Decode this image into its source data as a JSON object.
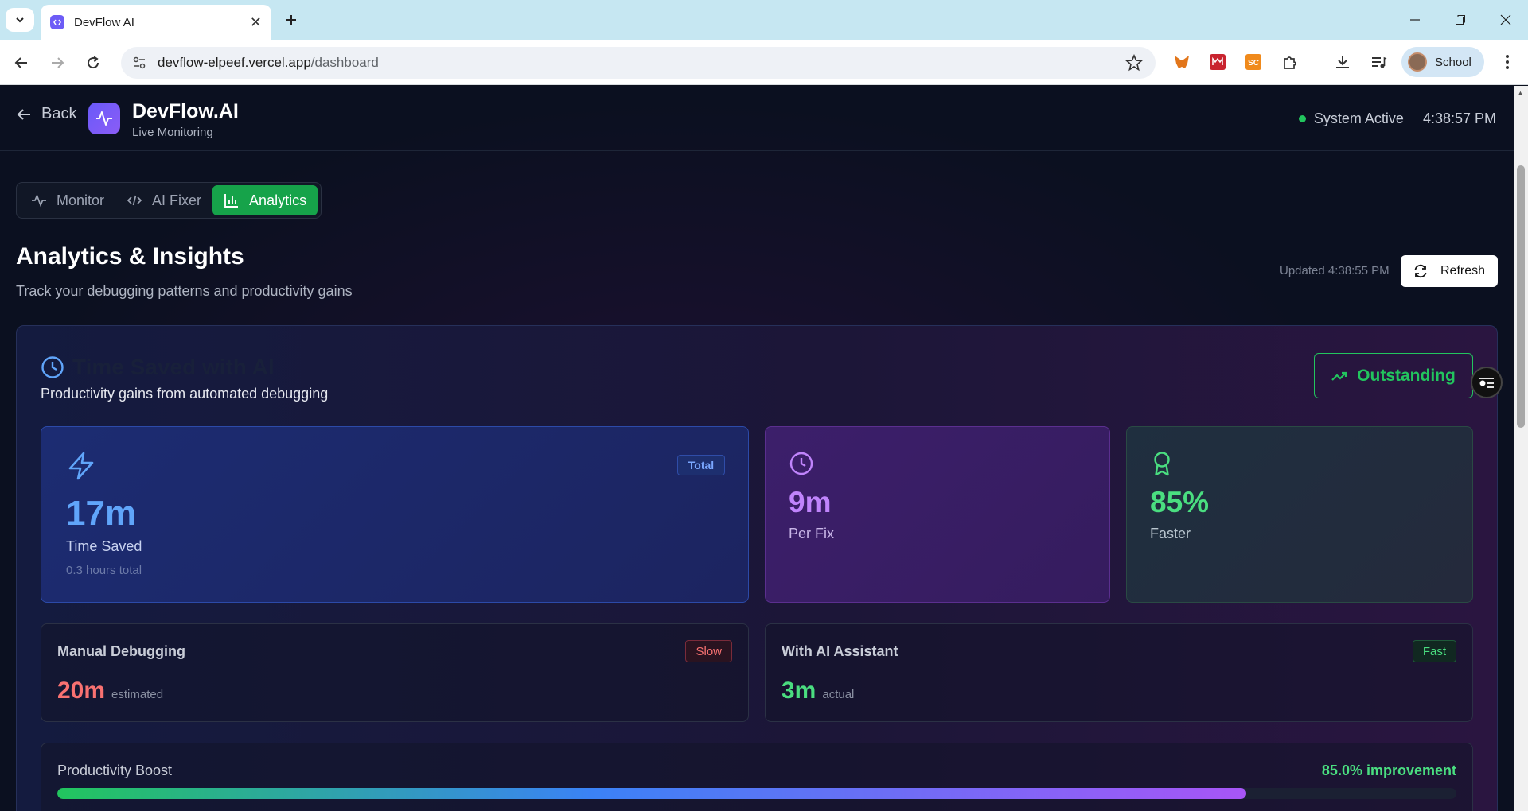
{
  "browser": {
    "tab_title": "DevFlow AI",
    "url_host": "devflow-elpeef.vercel.app",
    "url_path": "/dashboard",
    "profile_name": "School"
  },
  "header": {
    "back_label": "Back",
    "brand_name": "DevFlow.AI",
    "brand_subtitle": "Live Monitoring",
    "status_text": "System Active",
    "clock": "4:38:57 PM"
  },
  "tabs": [
    {
      "label": "Monitor",
      "active": false
    },
    {
      "label": "AI Fixer",
      "active": false
    },
    {
      "label": "Analytics",
      "active": true
    }
  ],
  "page": {
    "title": "Analytics & Insights",
    "subtitle": "Track your debugging patterns and productivity gains",
    "updated": "Updated 4:38:55 PM",
    "refresh_label": "Refresh"
  },
  "time_saved": {
    "title": "Time Saved with AI",
    "subtitle": "Productivity gains from automated debugging",
    "rating": "Outstanding",
    "total_badge": "Total",
    "total_value": "17m",
    "total_label": "Time Saved",
    "total_hours": "0.3 hours total",
    "per_fix_value": "9m",
    "per_fix_label": "Per Fix",
    "faster_value": "85%",
    "faster_label": "Faster"
  },
  "comparison": {
    "manual_title": "Manual Debugging",
    "manual_badge": "Slow",
    "manual_value": "20m",
    "manual_note": "estimated",
    "ai_title": "With AI Assistant",
    "ai_badge": "Fast",
    "ai_value": "3m",
    "ai_note": "actual"
  },
  "boost": {
    "title": "Productivity Boost",
    "improvement": "85.0% improvement",
    "fill_fraction": 0.85
  },
  "colors": {
    "accent_green": "#22c55e",
    "accent_blue": "#60a5fa",
    "accent_purple": "#c084fc",
    "slow_red": "#f87171"
  }
}
